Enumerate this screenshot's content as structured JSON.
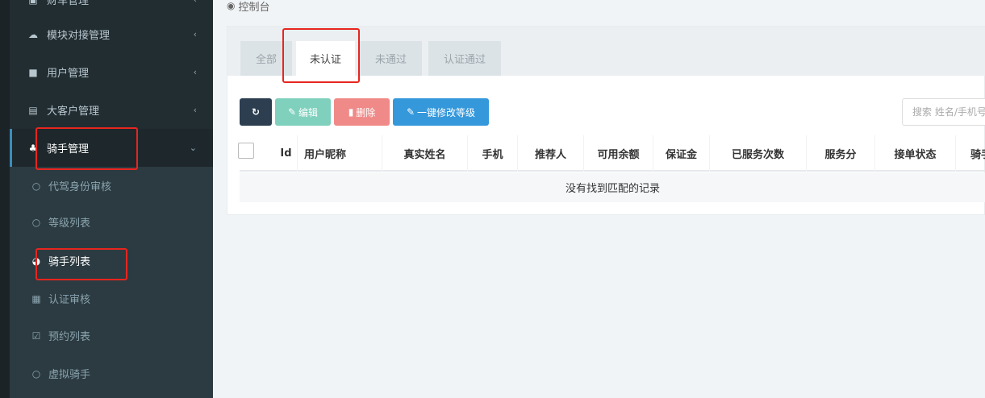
{
  "sidebar": {
    "items": [
      {
        "label": "财车管理",
        "icon": "car-icon"
      },
      {
        "label": "模块对接管理",
        "icon": "cloud-icon"
      },
      {
        "label": "用户管理",
        "icon": "user-book-icon"
      },
      {
        "label": "大客户管理",
        "icon": "contact-book-icon"
      },
      {
        "label": "骑手管理",
        "icon": "rider-group-icon"
      }
    ],
    "sub_items": [
      {
        "label": "代驾身份审核",
        "icon": "circle-icon"
      },
      {
        "label": "等级列表",
        "icon": "circle-icon"
      },
      {
        "label": "骑手列表",
        "icon": "rider-icon"
      },
      {
        "label": "认证审核",
        "icon": "id-card-icon"
      },
      {
        "label": "预约列表",
        "icon": "check-square-icon"
      },
      {
        "label": "虚拟骑手",
        "icon": "circle-icon"
      }
    ]
  },
  "breadcrumb": {
    "label": "控制台",
    "icon": "dashboard-icon"
  },
  "tabs": [
    {
      "label": "全部"
    },
    {
      "label": "未认证",
      "active": true
    },
    {
      "label": "未通过"
    },
    {
      "label": "认证通过"
    }
  ],
  "toolbar": {
    "edit_label": "编辑",
    "delete_label": "删除",
    "level_label": "一键修改等级"
  },
  "search": {
    "placeholder": "搜索 姓名/手机号"
  },
  "table": {
    "columns": [
      "Id",
      "用户昵称",
      "真实姓名",
      "手机",
      "推荐人",
      "可用余额",
      "保证金",
      "已服务次数",
      "服务分",
      "接单状态",
      "骑手"
    ],
    "empty_text": "没有找到匹配的记录"
  },
  "colors": {
    "sidebar_bg": "#222d32",
    "accent": "#3c8dbc",
    "highlight": "#e8251f"
  }
}
